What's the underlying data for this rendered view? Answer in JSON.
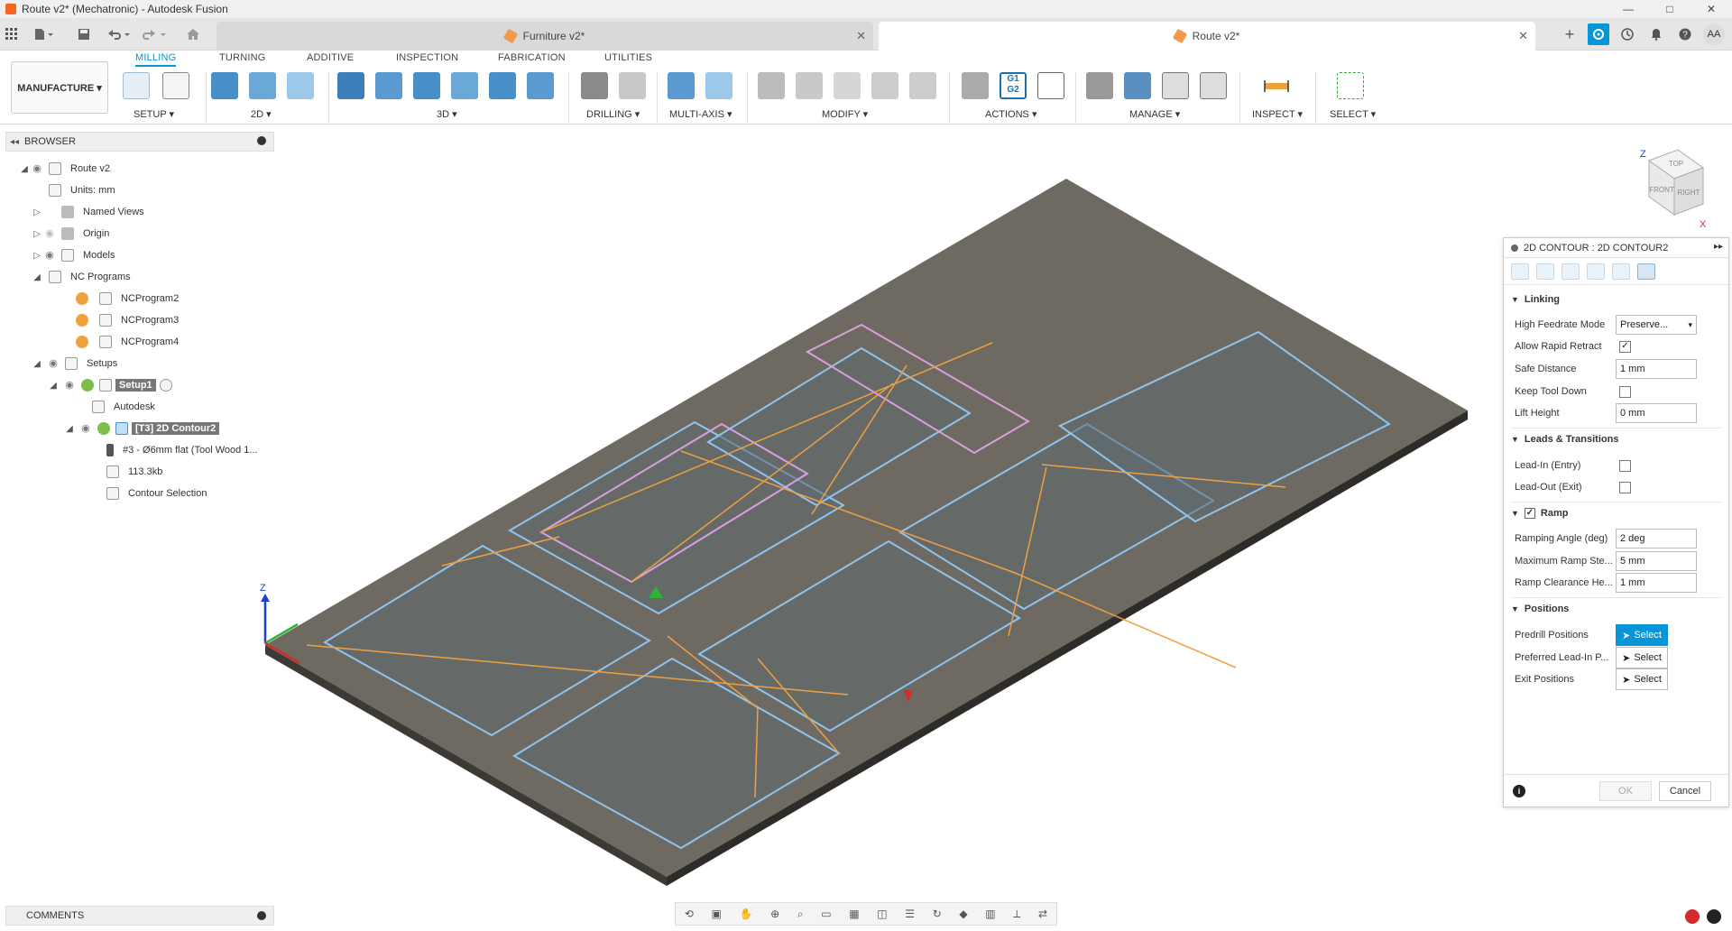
{
  "window": {
    "title": "Route v2* (Mechatronic) - Autodesk Fusion",
    "controls": [
      "—",
      "□",
      "✕"
    ]
  },
  "qat": {
    "grid_icon": "apps-grid-icon",
    "file_icon": "file-icon",
    "save_icon": "save-icon",
    "undo_icon": "undo-icon",
    "redo_icon": "redo-icon",
    "home_icon": "home-icon"
  },
  "doc_tabs": [
    {
      "label": "Furniture v2*",
      "active": false,
      "close": "✕"
    },
    {
      "label": "Route v2*",
      "active": true,
      "close": "✕"
    }
  ],
  "right_buttons": {
    "add": "+",
    "avatar": "AA"
  },
  "ribbon": {
    "workspace": "MANUFACTURE ▾",
    "tabs": [
      "MILLING",
      "TURNING",
      "ADDITIVE",
      "INSPECTION",
      "FABRICATION",
      "UTILITIES"
    ],
    "groups": [
      "SETUP ▾",
      "2D ▾",
      "3D ▾",
      "DRILLING ▾",
      "MULTI-AXIS ▾",
      "MODIFY ▾",
      "ACTIONS ▾",
      "MANAGE ▾",
      "INSPECT ▾",
      "SELECT ▾"
    ],
    "action_labels": {
      "g1g2": "G1\nG2"
    }
  },
  "browser": {
    "title": "BROWSER",
    "nodes": [
      {
        "label": "Route v2"
      },
      {
        "label": "Units: mm"
      },
      {
        "label": "Named Views"
      },
      {
        "label": "Origin"
      },
      {
        "label": "Models"
      },
      {
        "label": "NC Programs"
      },
      {
        "label": "NCProgram2"
      },
      {
        "label": "NCProgram3"
      },
      {
        "label": "NCProgram4"
      },
      {
        "label": "Setups"
      },
      {
        "label": "Setup1"
      },
      {
        "label": "Autodesk"
      },
      {
        "label": "[T3] 2D Contour2"
      },
      {
        "label": "#3 - Ø6mm flat (Tool Wood 1..."
      },
      {
        "label": "113.3kb"
      },
      {
        "label": "Contour Selection"
      }
    ]
  },
  "viewcube": {
    "top": "TOP",
    "front": "FRONT",
    "right": "RIGHT",
    "z": "Z",
    "x": "X"
  },
  "axis": {
    "z": "Z"
  },
  "panel": {
    "title": "2D CONTOUR : 2D CONTOUR2",
    "sections": {
      "linking": "Linking",
      "leads": "Leads & Transitions",
      "ramp": "Ramp",
      "positions": "Positions"
    },
    "fields": {
      "high_feedrate_mode": {
        "label": "High Feedrate Mode",
        "value": "Preserve..."
      },
      "allow_rapid_retract": {
        "label": "Allow Rapid Retract",
        "checked": "✓"
      },
      "safe_distance": {
        "label": "Safe Distance",
        "value": "1 mm"
      },
      "keep_tool_down": {
        "label": "Keep Tool Down"
      },
      "lift_height": {
        "label": "Lift Height",
        "value": "0 mm"
      },
      "lead_in": {
        "label": "Lead-In (Entry)"
      },
      "lead_out": {
        "label": "Lead-Out (Exit)"
      },
      "ramp_checked": "✓",
      "ramping_angle": {
        "label": "Ramping Angle (deg)",
        "value": "2 deg"
      },
      "max_ramp_step": {
        "label": "Maximum Ramp Ste...",
        "value": "5 mm"
      },
      "ramp_clearance": {
        "label": "Ramp Clearance He...",
        "value": "1 mm"
      },
      "predrill": {
        "label": "Predrill Positions",
        "button": "Select"
      },
      "preferred_lead_in": {
        "label": "Preferred Lead-In P...",
        "button": "Select"
      },
      "exit_positions": {
        "label": "Exit Positions",
        "button": "Select"
      }
    },
    "ok": "OK",
    "cancel": "Cancel",
    "info": "i"
  },
  "comments": {
    "title": "COMMENTS"
  },
  "colors": {
    "accent": "#0696d7",
    "stock": "#6e6a62",
    "contour_blue": "#8fc4f0",
    "contour_pink": "#d9a0e0",
    "rapid_orange": "#f0a040"
  }
}
